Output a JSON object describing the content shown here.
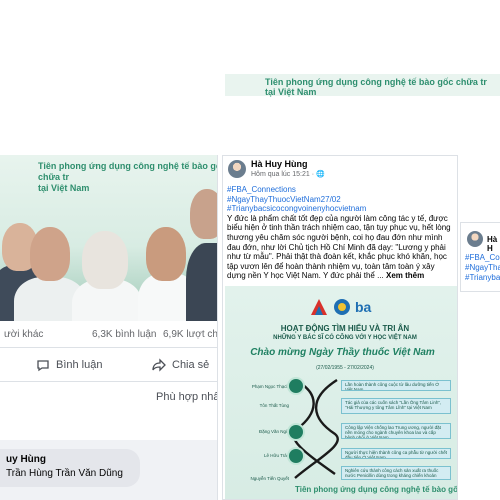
{
  "top_post": {
    "banner_line1": "Tiên phong ứng dụng công nghệ tế bào gốc chữa tr",
    "banner_line2": "Tiên phong ứng dụng công nghệ tế bào gốc chữa tr",
    "banner_line3": "tại Việt Nam"
  },
  "left_post": {
    "banner_tag_line1": "Tiên phong ứng dụng công nghệ tế bào gốc chữa tr",
    "banner_tag_line2": "tại Việt Nam",
    "stats": {
      "reactions_tail": "ười khác",
      "comments": "6,3K bình luận",
      "shares": "6,9K lượt chi"
    },
    "actions": {
      "comment": "Bình luận",
      "share": "Chia sẻ"
    },
    "fit_label": "Phù hợp nhấ",
    "comment": {
      "name": "uy Hùng",
      "text": "Trần Hùng Trần Văn Dũng"
    }
  },
  "mid_post": {
    "author": "Hà Huy Hùng",
    "time": "Hôm qua lúc 15:21 · 🌐",
    "hashtags": [
      "#FBA_Connections",
      "#NgayThayThuocVietNam27/02",
      "#Trianybacsicocongvoinenyhocvietnam"
    ],
    "body": "Y đức là phẩm chất tốt đẹp của người làm công tác y tế, được biểu hiện ở tinh thần trách nhiệm cao, tận tụy phục vụ, hết lòng thương yêu chăm sóc người bệnh, coi họ đau đớn như mình đau đớn, như lời Chủ tịch Hồ Chí Minh đã dạy: \"Lương y phải như từ mẫu\". Phải thật thà đoàn kết, khắc phục khó khăn, học tập vươn lên để hoàn thành nhiệm vụ, toàn tâm toàn ý xây dựng nền Y học Việt Nam. Y đức phải thể ...",
    "see_more": "Xem thêm",
    "poster": {
      "logo_text": "ba",
      "heading": "HOẠT ĐỘNG TÌM HIỂU VÀ TRI ÂN",
      "subheading": "NHỮNG Y BÁC SĨ CÓ CÔNG VỚI Y HỌC VIỆT NAM",
      "script_title": "Chào mừng Ngày Thầy thuốc Việt Nam",
      "dates": "(27/02/1955 - 27/02/2024)",
      "rows": [
        {
          "name": "Phạm Ngọc Thạch",
          "desc": "Lần hoàn thành công cuộc từ lâu dưỡng tiến Ở Việt Nam"
        },
        {
          "name": "Tôn Thất Tùng",
          "desc": "Tác giả của các cuốn sách \"Lần Ông Tâm Linh\", \"Hải Thượng y tông Tâm Lĩnh\" tại Việt Nam"
        },
        {
          "name": "Đặng Văn Ngữ",
          "desc": "Công lập Viện chống lao Trung ương, người đặt nền móng cho ngành chuyên khoa lao và cấp bệnh phổi ở Việt Nam"
        },
        {
          "name": "Lê Hữu Trác",
          "desc": "Người thực hiện thành công ca phẫu từ người chết đầu tiên Ở Việt Nam"
        },
        {
          "name": "Nguyễn Tiến Quyết",
          "desc": "Nghiên cứu thành công cách sản xuất ra thuốc nước Penicillin dùng trong kháng chiến khoản"
        }
      ],
      "footer": "Tiên phong ứng dụng công nghệ tế bào gốc chữa trị"
    }
  },
  "right_post": {
    "author": "Hà H",
    "tags": [
      "#FBA_Conn",
      "#NgayThayT",
      "#Trianybacs"
    ]
  },
  "colors": {
    "accent_green": "#2e8f6f",
    "poster_bg": "#e2f2ec",
    "link_blue": "#216fdb"
  }
}
